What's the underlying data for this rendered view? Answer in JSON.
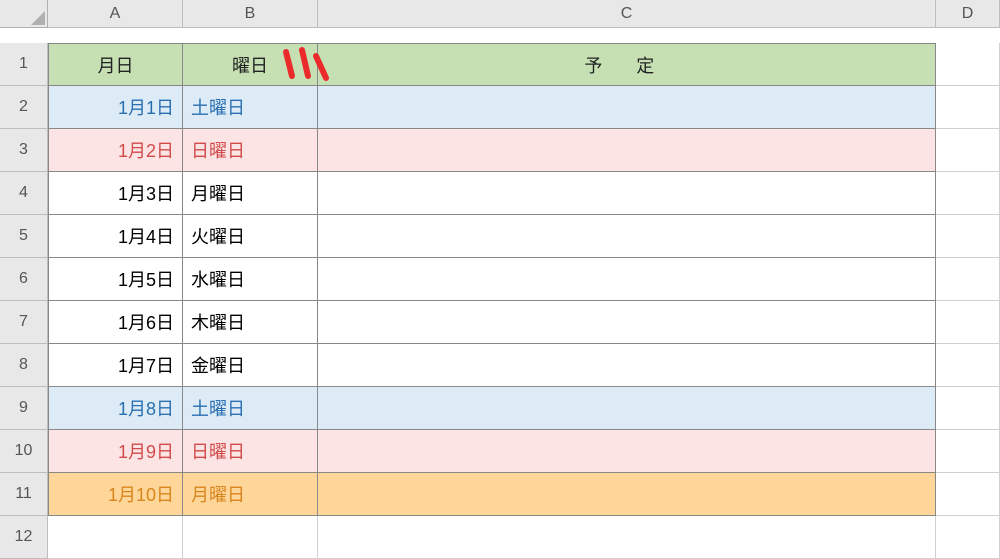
{
  "columns": [
    "A",
    "B",
    "C",
    "D"
  ],
  "rowNumbers": [
    "1",
    "2",
    "3",
    "4",
    "5",
    "6",
    "7",
    "8",
    "9",
    "10",
    "11",
    "12"
  ],
  "headers": {
    "A": "月日",
    "B": "曜日",
    "C": "予 定"
  },
  "rows": [
    {
      "date": "1月1日",
      "day": "土曜日",
      "bg": "blue",
      "txt": "blue"
    },
    {
      "date": "1月2日",
      "day": "日曜日",
      "bg": "pink",
      "txt": "red"
    },
    {
      "date": "1月3日",
      "day": "月曜日",
      "bg": "",
      "txt": ""
    },
    {
      "date": "1月4日",
      "day": "火曜日",
      "bg": "",
      "txt": ""
    },
    {
      "date": "1月5日",
      "day": "水曜日",
      "bg": "",
      "txt": ""
    },
    {
      "date": "1月6日",
      "day": "木曜日",
      "bg": "",
      "txt": ""
    },
    {
      "date": "1月7日",
      "day": "金曜日",
      "bg": "",
      "txt": ""
    },
    {
      "date": "1月8日",
      "day": "土曜日",
      "bg": "blue",
      "txt": "blue"
    },
    {
      "date": "1月9日",
      "day": "日曜日",
      "bg": "pink",
      "txt": "red"
    },
    {
      "date": "1月10日",
      "day": "月曜日",
      "bg": "orange",
      "txt": "orange"
    }
  ],
  "colors": {
    "headerBg": "#c6e0b4",
    "blueBg": "#ddebf7",
    "pinkBg": "#fce4e4",
    "orangeBg": "#ffd699",
    "blueTxt": "#2a6fb0",
    "redTxt": "#d14b4b",
    "orangeTxt": "#d8851c",
    "annotation": "#eb2b2b"
  }
}
